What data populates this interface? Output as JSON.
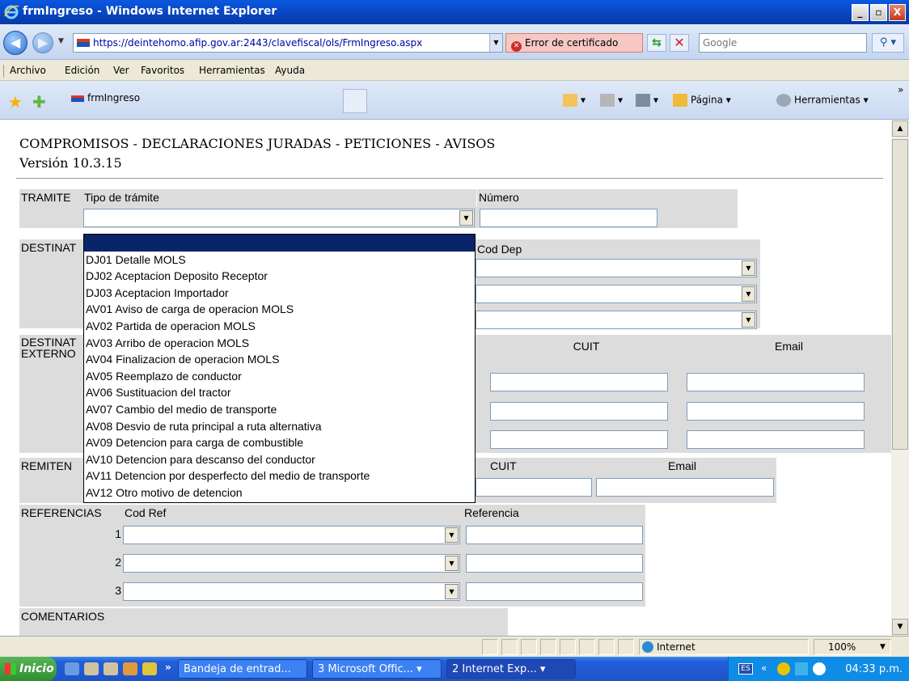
{
  "window": {
    "title": "frmIngreso - Windows Internet Explorer",
    "buttons": [
      "_",
      "▫",
      "X"
    ]
  },
  "address": {
    "url": "https://deintehomo.afip.gov.ar:2443/clavefiscal/ols/FrmIngreso.aspx",
    "cert_error": "Error de certificado",
    "search_placeholder": "Google"
  },
  "menu": [
    "Archivo",
    "Edición",
    "Ver",
    "Favoritos",
    "Herramientas",
    "Ayuda"
  ],
  "favbar": {
    "tab_title": "frmIngreso",
    "pagina": "Página",
    "herramientas": "Herramientas"
  },
  "page": {
    "title": "COMPROMISOS - DECLARACIONES JURADAS - PETICIONES - AVISOS",
    "version": "Versión 10.3.15",
    "tramite": {
      "label": "TRAMITE",
      "tipo_header": "Tipo de trámite",
      "numero_header": "Número"
    },
    "destinatario": {
      "label": "DESTINAT",
      "cod_dep_header": "Cod Dep"
    },
    "destinatario_externo": {
      "label1": "DESTINAT",
      "label2": "EXTERNO",
      "cuit_header": "CUIT",
      "email_header": "Email"
    },
    "remitente": {
      "label": "REMITEN",
      "cuit_header": "CUIT",
      "email_header": "Email"
    },
    "referencias": {
      "label": "REFERENCIAS",
      "cod_ref_header": "Cod Ref",
      "referencia_header": "Referencia",
      "rows": [
        "1",
        "2",
        "3"
      ]
    },
    "comentarios": {
      "label": "COMENTARIOS"
    }
  },
  "dropdown_options": [
    "",
    "DJ01 Detalle MOLS",
    "DJ02 Aceptacion Deposito Receptor",
    "DJ03 Aceptacion Importador",
    "AV01 Aviso de carga de operacion MOLS",
    "AV02 Partida de operacion MOLS",
    "AV03 Arribo de operacion MOLS",
    "AV04 Finalizacion de operacion MOLS",
    "AV05 Reemplazo de conductor",
    "AV06 Sustituacion del tractor",
    "AV07 Cambio del medio de transporte",
    "AV08 Desvio de ruta principal a ruta alternativa",
    "AV09 Detencion para carga de combustible",
    "AV10 Detencion para descanso del conductor",
    "AV11 Detencion por desperfecto del medio de transporte",
    "AV12 Otro motivo de detencion"
  ],
  "status": {
    "zone": "Internet",
    "zoom": "100%"
  },
  "taskbar": {
    "start": "Inicio",
    "items": [
      "Bandeja de entrad...",
      "3 Microsoft Offic...",
      "2 Internet Exp..."
    ],
    "lang": "ES",
    "clock": "04:33 p.m."
  },
  "colors": {
    "title_bar": "#0847c4",
    "selected_option": "#0a246a",
    "cell_bg": "#dcdcdc",
    "cert_error_bg": "#f6c8c4"
  }
}
